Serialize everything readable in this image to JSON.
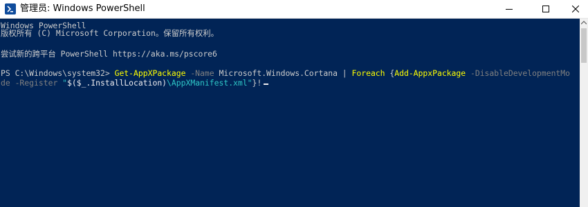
{
  "window": {
    "title": "管理员: Windows PowerShell"
  },
  "controls": {
    "minimize_icon": "minimize-icon",
    "maximize_icon": "maximize-icon",
    "close_icon": "close-icon"
  },
  "console": {
    "header_line1": "Windows PowerShell",
    "header_line2": "版权所有 (C) Microsoft Corporation。保留所有权利。",
    "hint_line": "尝试新的跨平台 PowerShell https://aka.ms/pscore6",
    "prompt": "PS C:\\Windows\\system32> ",
    "cmd_get": "Get-AppXPackage",
    "param_name": " -Name",
    "arg_name": " Microsoft.Windows.Cortana",
    "pipe": " | ",
    "cmd_foreach": "Foreach",
    "brace_open": " {",
    "cmd_add": "Add-AppxPackage",
    "param_dev": " -DisableDevelopmentMo",
    "param_dev_cont": "de",
    "param_register": " -Register",
    "str_open": " \"",
    "str_var": "$(",
    "str_var_name": "$_",
    "str_var_prop": ".InstallLocation)",
    "str_path": "\\AppXManifest.xml",
    "str_close": "\"",
    "brace_close": "}",
    "bang": "!"
  },
  "colors": {
    "console_background": "#012456",
    "console_text": "#cccccc",
    "command": "#ffff00",
    "parameter": "#808080",
    "string": "#2ec7c7"
  }
}
